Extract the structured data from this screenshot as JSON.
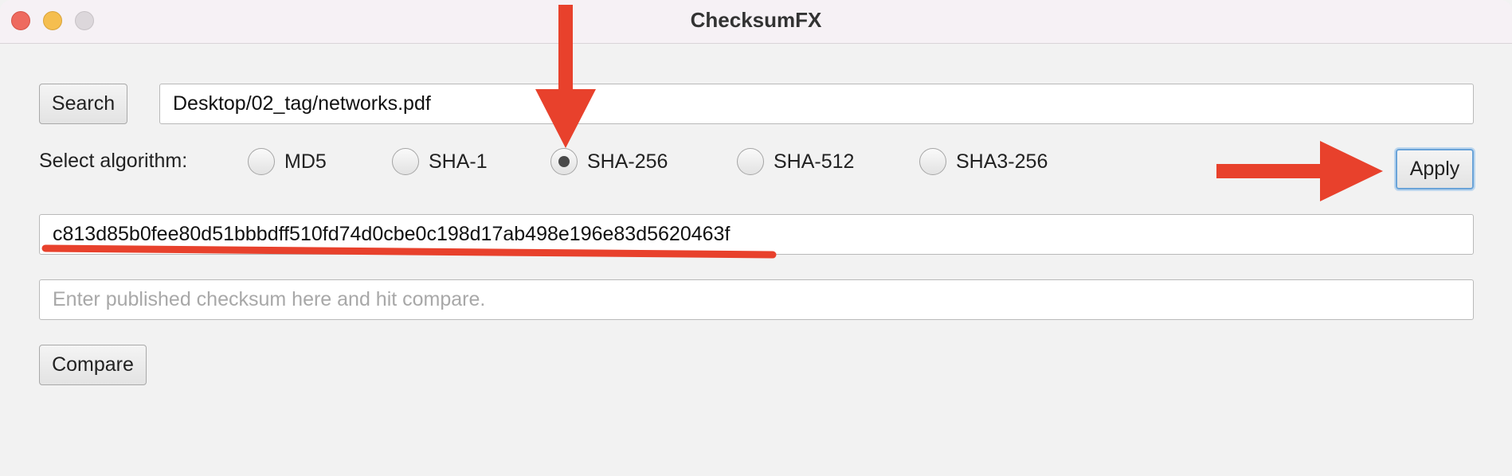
{
  "window": {
    "title": "ChecksumFX"
  },
  "file_row": {
    "search_label": "Search",
    "path_value": "Desktop/02_tag/networks.pdf"
  },
  "algorithm_row": {
    "label": "Select algorithm:",
    "options": [
      {
        "label": "MD5",
        "selected": false
      },
      {
        "label": "SHA-1",
        "selected": false
      },
      {
        "label": "SHA-256",
        "selected": true
      },
      {
        "label": "SHA-512",
        "selected": false
      },
      {
        "label": "SHA3-256",
        "selected": false
      }
    ],
    "apply_label": "Apply"
  },
  "result": {
    "checksum_value": "c813d85b0fee80d51bbbdff510fd74d0cbe0c198d17ab498e196e83d5620463f"
  },
  "compare": {
    "placeholder": "Enter published checksum here and hit compare.",
    "value": "",
    "button_label": "Compare"
  },
  "colors": {
    "annotation_red": "#e8412c",
    "apply_focus_blue": "#6aa3d8"
  }
}
